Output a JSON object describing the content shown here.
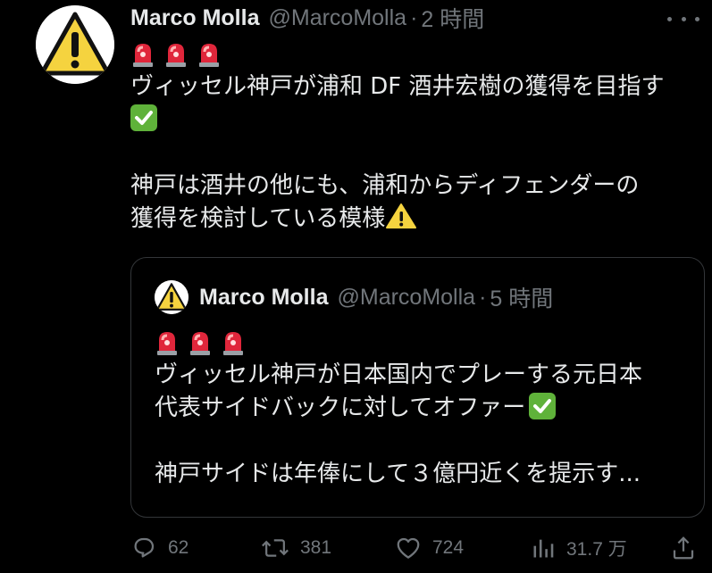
{
  "tweet": {
    "author_name": "Marco Molla",
    "handle": "@MarcoMolla",
    "separator": "·",
    "time": "2 時間",
    "line1": "ヴィッセル神戸が浦和 DF 酒井宏樹の獲得を目指す",
    "line2": "神戸は酒井の他にも、浦和からディフェンダーの",
    "line3": "獲得を検討している模様"
  },
  "quote": {
    "author_name": "Marco Molla",
    "handle": "@MarcoMolla",
    "separator": "·",
    "time": "5 時間",
    "line1": "ヴィッセル神戸が日本国内でプレーする元日本",
    "line2": "代表サイドバックに対してオファー",
    "line3": "神戸サイドは年俸にして３億円近くを提示す..."
  },
  "actions": {
    "replies": "62",
    "retweets": "381",
    "likes": "724",
    "views": "31.7 万"
  },
  "colors": {
    "background": "#000000",
    "text": "#e7e9ea",
    "secondary": "#71767b",
    "border": "#333639",
    "check_green": "#5fb23a",
    "warning_yellow": "#f5d33f",
    "siren_red": "#e0263b"
  },
  "icons": [
    "warning-avatar-icon",
    "siren-emoji",
    "check-emoji",
    "warning-emoji",
    "more-icon",
    "reply-icon",
    "retweet-icon",
    "like-icon",
    "views-icon",
    "share-icon"
  ]
}
